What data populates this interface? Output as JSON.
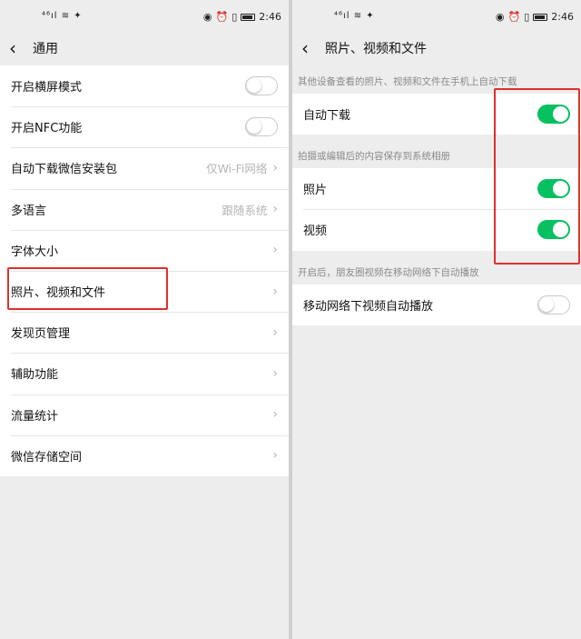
{
  "status_bar": {
    "signal": "⁴⁶ıl ≋ ✦",
    "time": "2:46",
    "icons": [
      "eye-icon",
      "alarm-icon",
      "vibrate-icon",
      "battery-icon"
    ]
  },
  "left": {
    "title": "通用",
    "items": [
      {
        "label": "开启横屏模式",
        "toggle": "off"
      },
      {
        "label": "开启NFC功能",
        "toggle": "off"
      },
      {
        "label": "自动下载微信安装包",
        "value": "仅Wi-Fi网络"
      },
      {
        "label": "多语言",
        "value": "跟随系统"
      },
      {
        "label": "字体大小"
      },
      {
        "label": "照片、视频和文件"
      },
      {
        "label": "发现页管理"
      },
      {
        "label": "辅助功能"
      },
      {
        "label": "流量统计"
      },
      {
        "label": "微信存储空间"
      }
    ]
  },
  "right": {
    "title": "照片、视频和文件",
    "hint1": "其他设备查看的照片、视频和文件在手机上自动下载",
    "auto_download": {
      "label": "自动下载",
      "toggle": "on"
    },
    "hint2": "拍摄或编辑后的内容保存到系统相册",
    "photo": {
      "label": "照片",
      "toggle": "on"
    },
    "video": {
      "label": "视频",
      "toggle": "on"
    },
    "hint3": "开启后，朋友圈视频在移动网络下自动播放",
    "mobile_autoplay": {
      "label": "移动网络下视频自动播放",
      "toggle": "off"
    }
  },
  "colors": {
    "accent_green": "#07c160",
    "highlight_red": "#e0302d"
  }
}
